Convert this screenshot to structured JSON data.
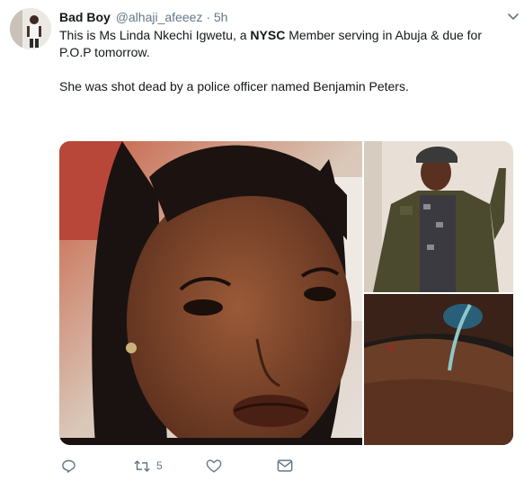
{
  "tweet": {
    "author": {
      "display_name": "Bad Boy",
      "handle": "@alhaji_afeeez",
      "separator": "·",
      "time": "5h"
    },
    "text": {
      "line1_part1": "This is Ms Linda Nkechi Igwetu, a ",
      "line1_bold": "NYSC",
      "line1_part2": " Member serving in Abuja & due for P.O.P tomorrow.",
      "paragraph2": "She was shot dead by a police officer named Benjamin Peters."
    },
    "media": {
      "photos": [
        {
          "subject": "selfie of a woman"
        },
        {
          "subject": "man in camouflage uniform"
        },
        {
          "subject": "close-up of injury"
        }
      ]
    },
    "actions": {
      "reply": {
        "icon": "reply-icon",
        "count": ""
      },
      "retweet": {
        "icon": "retweet-icon",
        "count": "5"
      },
      "like": {
        "icon": "heart-icon",
        "count": ""
      },
      "message": {
        "icon": "envelope-icon",
        "count": ""
      }
    },
    "colors": {
      "text": "#14171a",
      "secondary": "#657786"
    }
  }
}
